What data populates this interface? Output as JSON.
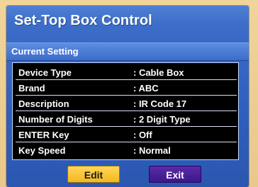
{
  "window": {
    "title": "Set-Top Box Control"
  },
  "section": {
    "label": "Current Setting"
  },
  "settings": [
    {
      "label": "Device Type",
      "value": ": Cable Box"
    },
    {
      "label": "Brand",
      "value": ": ABC"
    },
    {
      "label": "Description",
      "value": ": IR Code 17"
    },
    {
      "label": "Number of Digits",
      "value": ": 2 Digit Type"
    },
    {
      "label": "ENTER Key",
      "value": ": Off"
    },
    {
      "label": "Key Speed",
      "value": ": Normal"
    }
  ],
  "buttons": {
    "edit_label": "Edit",
    "exit_label": "Exit"
  },
  "colors": {
    "panel_blue": "#2e5fbd",
    "edit_button": "#f4b81c",
    "exit_button": "#3d178a",
    "table_background": "#000000",
    "frame": "#e9c88a"
  }
}
